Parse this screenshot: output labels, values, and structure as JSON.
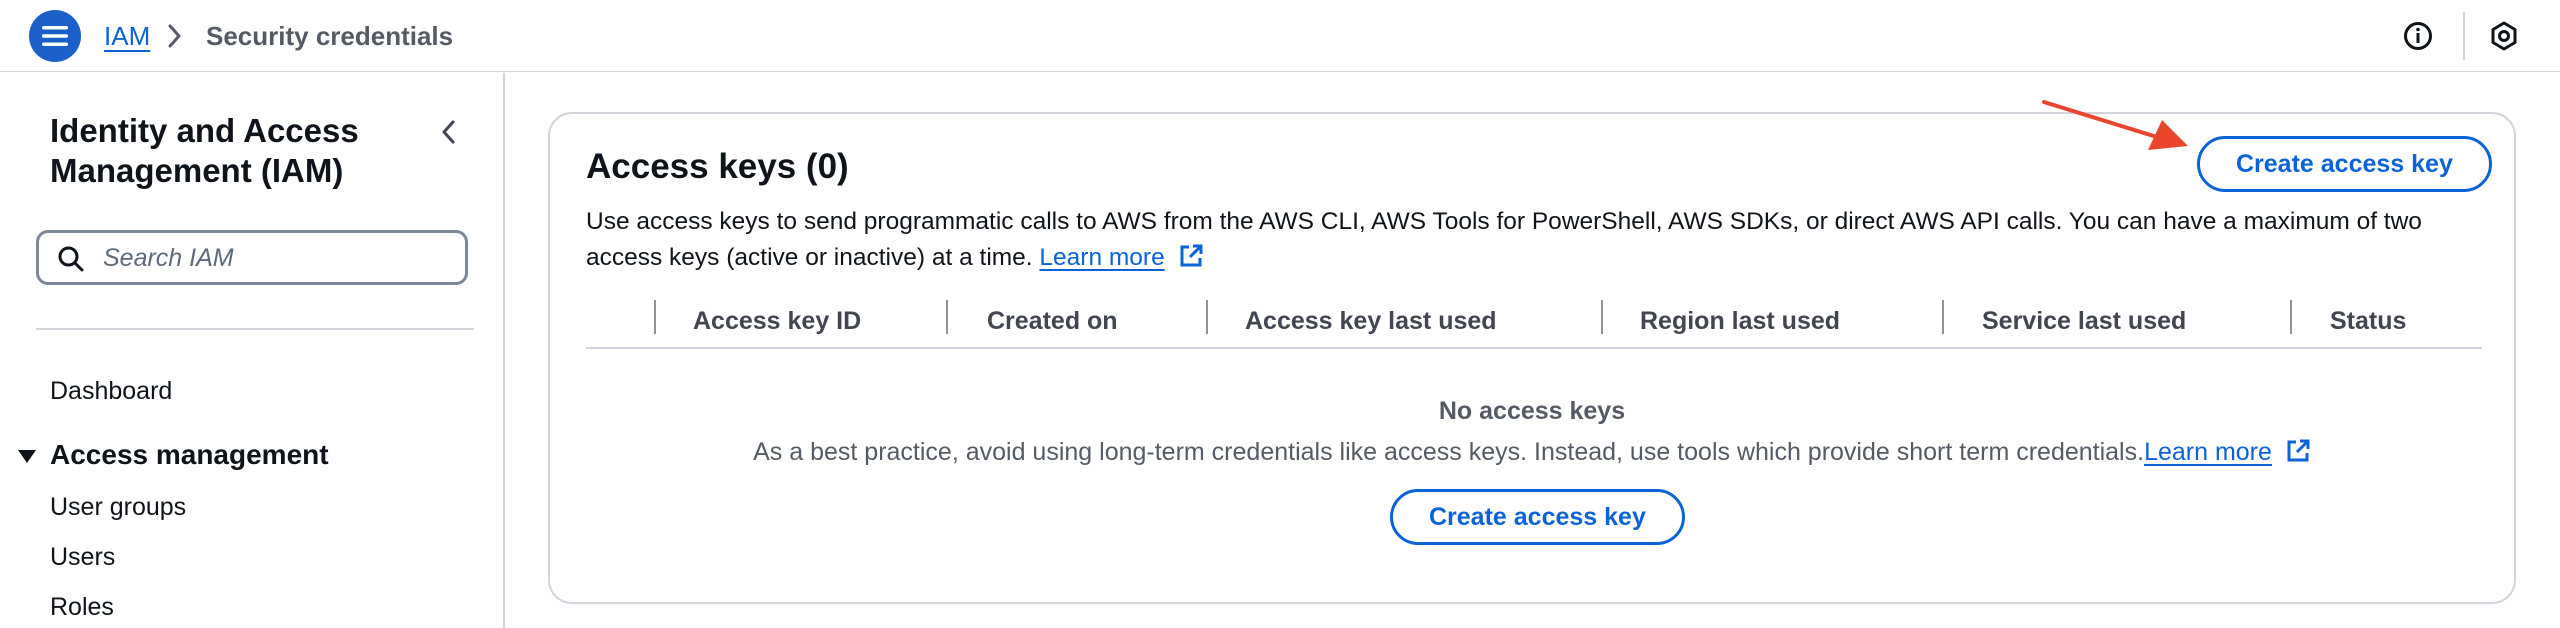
{
  "header": {
    "breadcrumb_service": "IAM",
    "breadcrumb_current": "Security credentials"
  },
  "sidebar": {
    "title": "Identity and Access Management (IAM)",
    "search_placeholder": "Search IAM",
    "items": [
      {
        "label": "Dashboard"
      },
      {
        "label": "Access management"
      },
      {
        "label": "User groups"
      },
      {
        "label": "Users"
      },
      {
        "label": "Roles"
      }
    ]
  },
  "access_keys": {
    "title": "Access keys (0)",
    "create_button_label": "Create access key",
    "description": "Use access keys to send programmatic calls to AWS from the AWS CLI, AWS Tools for PowerShell, AWS SDKs, or direct AWS API calls. You can have a maximum of two access keys (active or inactive) at a time.",
    "learn_more": "Learn more",
    "columns": [
      "Access key ID",
      "Created on",
      "Access key last used",
      "Region last used",
      "Service last used",
      "Status"
    ],
    "empty_title": "No access keys",
    "empty_description": "As a best practice, avoid using long-term credentials like access keys. Instead, use tools which provide short term credentials.",
    "empty_learn_more": "Learn more",
    "empty_create_button_label": "Create access key"
  },
  "colors": {
    "accent": "#0a64d8",
    "annotation_arrow": "#e8452c"
  }
}
